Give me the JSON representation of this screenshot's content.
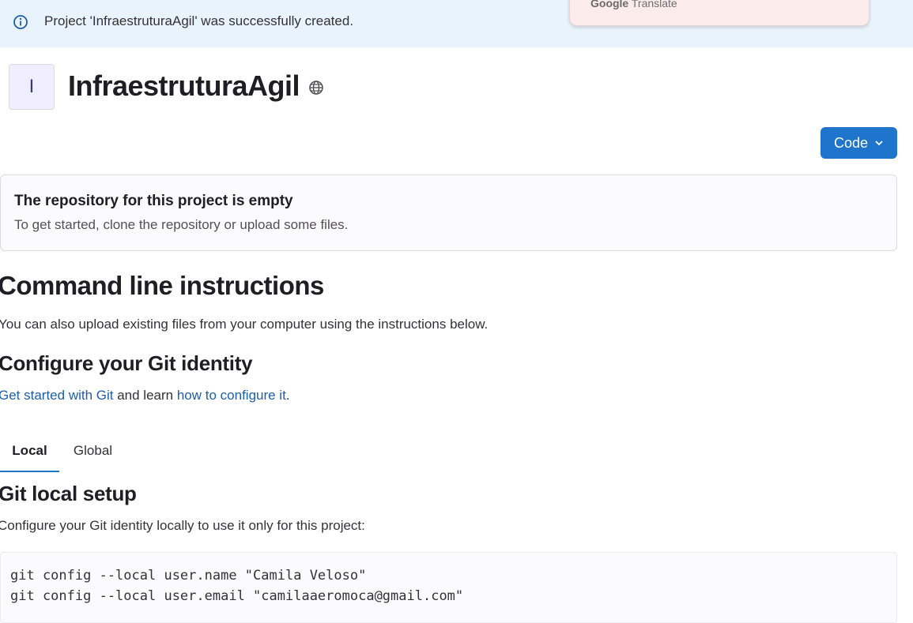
{
  "alert": {
    "icon": "info-icon",
    "message": "Project 'InfraestruturaAgil' was successfully created."
  },
  "translate_popup": {
    "brand_bold": "Google",
    "brand_rest": " Translate"
  },
  "project": {
    "avatar_letter": "I",
    "title": "InfraestruturaAgil",
    "visibility_icon": "globe-icon",
    "code_button_label": "Code"
  },
  "empty_repo": {
    "title": "The repository for this project is empty",
    "description": "To get started, clone the repository or upload some files."
  },
  "instructions": {
    "heading": "Command line instructions",
    "intro": "You can also upload existing files from your computer using the instructions below.",
    "identity_heading": "Configure your Git identity",
    "link_get_started": "Get started with Git",
    "text_and_learn": " and learn ",
    "link_configure": "how to configure it",
    "text_period": ".",
    "tabs": [
      {
        "label": "Local",
        "active": true
      },
      {
        "label": "Global",
        "active": false
      }
    ],
    "setup_heading": "Git local setup",
    "setup_desc": "Configure your Git identity locally to use it only for this project:",
    "code_lines": [
      "git config --local user.name \"Camila Veloso\"",
      "git config --local user.email \"camilaaeromoca@gmail.com\""
    ]
  },
  "colors": {
    "alert_bg": "#e9f3fc",
    "primary_button": "#1f75cb",
    "link": "#1f5fa6"
  }
}
